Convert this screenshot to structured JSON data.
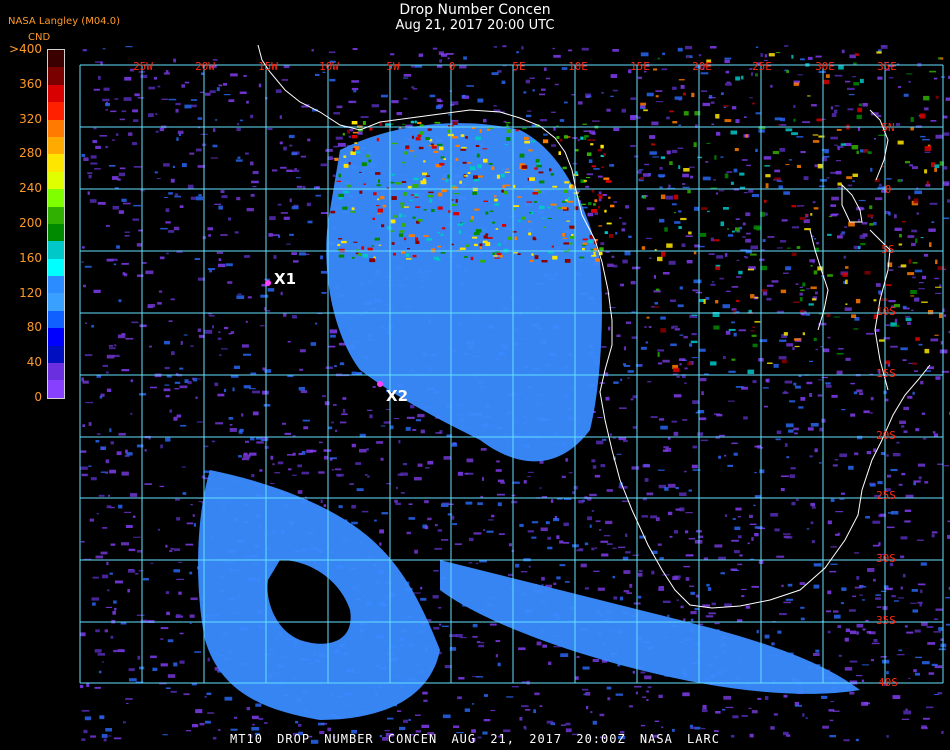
{
  "header": {
    "title": "Drop Number Concen",
    "subtitle": "Aug 21, 2017 20:00 UTC",
    "agency": "NASA Langley (M04.0)"
  },
  "colorbar": {
    "title": "CND",
    "labels": [
      ">400",
      "360",
      "320",
      "280",
      "240",
      "200",
      "160",
      "120",
      "80",
      "40",
      "0"
    ],
    "colors": [
      "#3a0000",
      "#7a0000",
      "#d80000",
      "#ff2000",
      "#ff7a00",
      "#ffaa00",
      "#ffe600",
      "#e0ff00",
      "#80ff00",
      "#30b000",
      "#008a00",
      "#00c8c8",
      "#00ffff",
      "#2a8cff",
      "#3aa0ff",
      "#1060ff",
      "#0000ff",
      "#0010c0",
      "#6a30e0",
      "#8840ff"
    ]
  },
  "map": {
    "lon_labels": [
      "25W",
      "20W",
      "15W",
      "10W",
      "5W",
      "0",
      "5E",
      "10E",
      "15E",
      "20E",
      "25E",
      "30E",
      "35E"
    ],
    "lat_labels": [
      "5N",
      "0",
      "5S",
      "10S",
      "15S",
      "20S",
      "25S",
      "30S",
      "35S",
      "40S"
    ],
    "markers": [
      {
        "label": "X1"
      },
      {
        "label": "X2"
      }
    ],
    "colors": {
      "grid": "#66e0ff",
      "coast": "#ffffff",
      "label": "#ff2a10",
      "cloud_main": "#3a8cff",
      "cloud_low": "#7a3ae0",
      "marker_text": "#ffffff"
    }
  },
  "footer": {
    "text": "MT10  DROP NUMBER CONCEN   AUG 21, 2017 20:00Z   NASA LARC"
  }
}
